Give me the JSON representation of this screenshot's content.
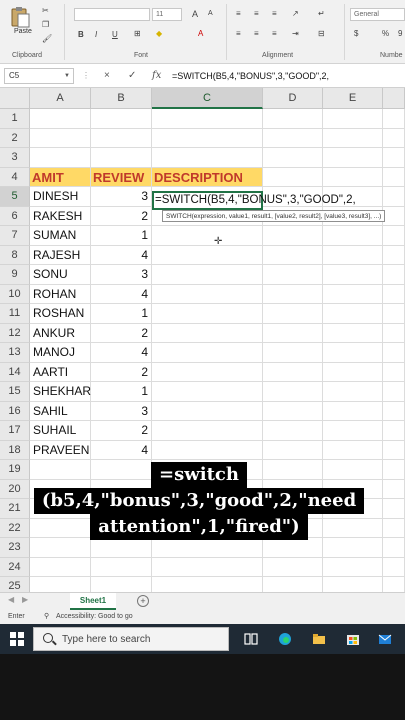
{
  "ribbon": {
    "paste_label": "Paste",
    "font_size": "11",
    "number_format": "General",
    "group_labels": [
      "Clipboard",
      "Font",
      "Alignment",
      "Numbe"
    ],
    "buttons": [
      "B",
      "I",
      "U",
      "A",
      "A",
      "%",
      "9"
    ]
  },
  "formula_bar": {
    "name_box": "C5",
    "cancel_icon": "×",
    "enter_icon": "✓",
    "fx_label": "fx",
    "formula": "=SWITCH(B5,4,\"BONUS\",3,\"GOOD\",2,"
  },
  "columns": [
    "A",
    "B",
    "C",
    "D",
    "E"
  ],
  "rows": [
    "1",
    "2",
    "3",
    "4",
    "5",
    "6",
    "7",
    "8",
    "9",
    "10",
    "11",
    "12",
    "13",
    "14",
    "15",
    "16",
    "17",
    "18",
    "19",
    "20",
    "21",
    "22",
    "23",
    "24",
    "25"
  ],
  "headers": {
    "a": "AMIT",
    "b": "REVIEW",
    "c": "DESCRIPTION"
  },
  "data": [
    {
      "name": "DINESH",
      "review": "3"
    },
    {
      "name": "RAKESH",
      "review": "2"
    },
    {
      "name": "SUMAN",
      "review": "1"
    },
    {
      "name": "RAJESH",
      "review": "4"
    },
    {
      "name": "SONU",
      "review": "3"
    },
    {
      "name": "ROHAN",
      "review": "4"
    },
    {
      "name": "ROSHAN",
      "review": "1"
    },
    {
      "name": "ANKUR",
      "review": "2"
    },
    {
      "name": "MANOJ",
      "review": "4"
    },
    {
      "name": "AARTI",
      "review": "2"
    },
    {
      "name": "SHEKHAR",
      "review": "1"
    },
    {
      "name": "SAHIL",
      "review": "3"
    },
    {
      "name": "SUHAIL",
      "review": "2"
    },
    {
      "name": "PRAVEEN",
      "review": "4"
    }
  ],
  "active_cell_text": "=SWITCH(B5,4,\"BONUS\",3,\"GOOD\",2,",
  "tooltip": "SWITCH(expression, value1, result1, [value2, result2], [value3, result3], ...)",
  "caption": {
    "line1": "=switch",
    "line2": "(b5,4,\"bonus\",3,\"good\",2,\"need",
    "line3": "attention\",1,\"fired\")"
  },
  "sheet_tab": "Sheet1",
  "add_sheet": "+",
  "status": {
    "mode": "Enter",
    "accessibility": "Accessibility: Good to go"
  },
  "taskbar": {
    "search_placeholder": "Type here to search"
  }
}
